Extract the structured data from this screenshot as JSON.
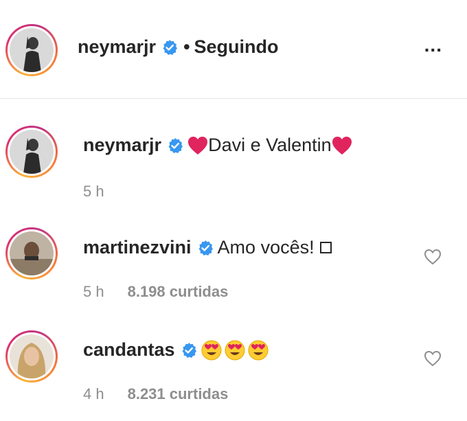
{
  "post_header": {
    "username": "neymarjr",
    "separator": "•",
    "follow_status": "Seguindo",
    "more_label": "..."
  },
  "comments": [
    {
      "username": "neymarjr",
      "text": "Davi e Valentin",
      "time": "5 h",
      "likes": ""
    },
    {
      "username": "martinezvini",
      "text": "Amo vocês!",
      "time": "5 h",
      "likes": "8.198 curtidas"
    },
    {
      "username": "candantas",
      "text": "",
      "time": "4 h",
      "likes": "8.231 curtidas"
    }
  ],
  "colors": {
    "verified_blue": "#3897f0",
    "heart_red": "#e0245e",
    "meta_gray": "#8e8e8e"
  },
  "icons": [
    "verified-badge-icon",
    "heart-emoji-icon",
    "heart-eyes-emoji-icon",
    "like-heart-icon",
    "more-options-icon"
  ]
}
